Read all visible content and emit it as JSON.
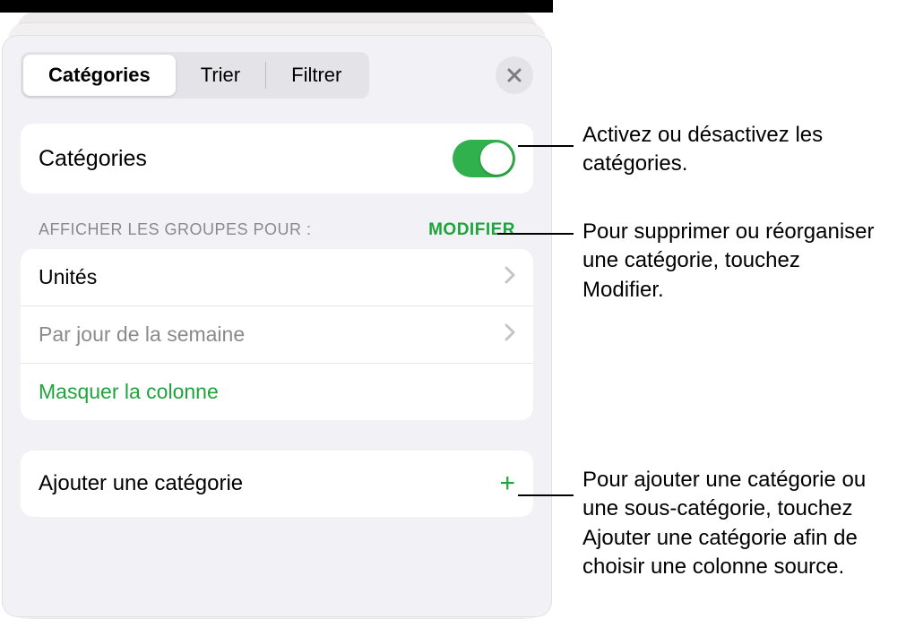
{
  "tabs": {
    "categories": "Catégories",
    "sort": "Trier",
    "filter": "Filtrer"
  },
  "toggle": {
    "label": "Catégories"
  },
  "groups": {
    "header": "AFFICHER LES GROUPES POUR :",
    "edit": "MODIFIER",
    "items": [
      {
        "label": "Unités",
        "dim": false
      },
      {
        "label": "Par jour de la semaine",
        "dim": true
      }
    ],
    "hide": "Masquer la colonne"
  },
  "add": {
    "label": "Ajouter une catégorie"
  },
  "callouts": {
    "toggle": "Activez ou désactivez les catégories.",
    "edit": "Pour supprimer ou réorganiser une catégorie, touchez Modifier.",
    "add": "Pour ajouter une catégorie ou une sous-catégorie, touchez Ajouter une catégorie afin de choisir une colonne source."
  }
}
